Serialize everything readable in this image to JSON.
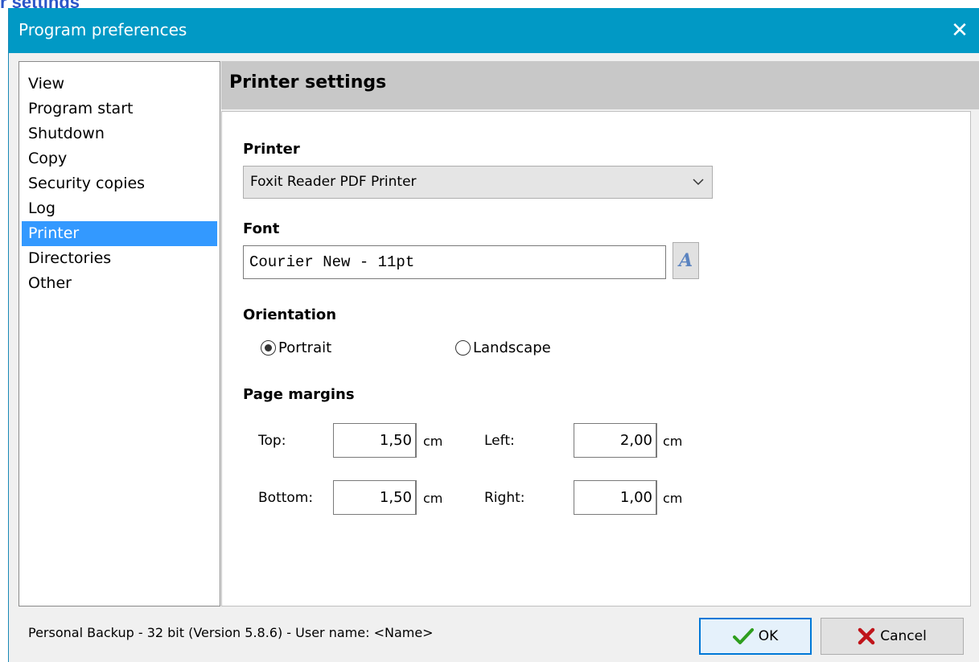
{
  "behind_window_title": "r settings",
  "window": {
    "title": "Program preferences"
  },
  "nav": {
    "items": [
      {
        "label": "View"
      },
      {
        "label": "Program start"
      },
      {
        "label": "Shutdown"
      },
      {
        "label": "Copy"
      },
      {
        "label": "Security copies"
      },
      {
        "label": "Log"
      },
      {
        "label": "Printer",
        "selected": true
      },
      {
        "label": "Directories"
      },
      {
        "label": "Other"
      }
    ]
  },
  "panel": {
    "title": "Printer settings",
    "printer": {
      "label": "Printer",
      "value": "Foxit Reader PDF Printer"
    },
    "font": {
      "label": "Font",
      "value": "Courier New - 11pt",
      "button_glyph": "A"
    },
    "orientation": {
      "label": "Orientation",
      "options": [
        {
          "label": "Portrait",
          "checked": true
        },
        {
          "label": "Landscape",
          "checked": false
        }
      ]
    },
    "margins": {
      "label": "Page margins",
      "unit": "cm",
      "top": {
        "label": "Top:",
        "value": "1,50"
      },
      "left": {
        "label": "Left:",
        "value": "2,00"
      },
      "bottom": {
        "label": "Bottom:",
        "value": "1,50"
      },
      "right": {
        "label": "Right:",
        "value": "1,00"
      }
    }
  },
  "footer": {
    "status": "Personal Backup - 32 bit (Version 5.8.6) - User name: <Name>",
    "ok_label": "OK",
    "cancel_label": "Cancel"
  },
  "colors": {
    "titlebar": "#0199c5",
    "selection": "#3399ff",
    "ok_icon": "#2e9e1e",
    "cancel_icon": "#c0141a"
  }
}
